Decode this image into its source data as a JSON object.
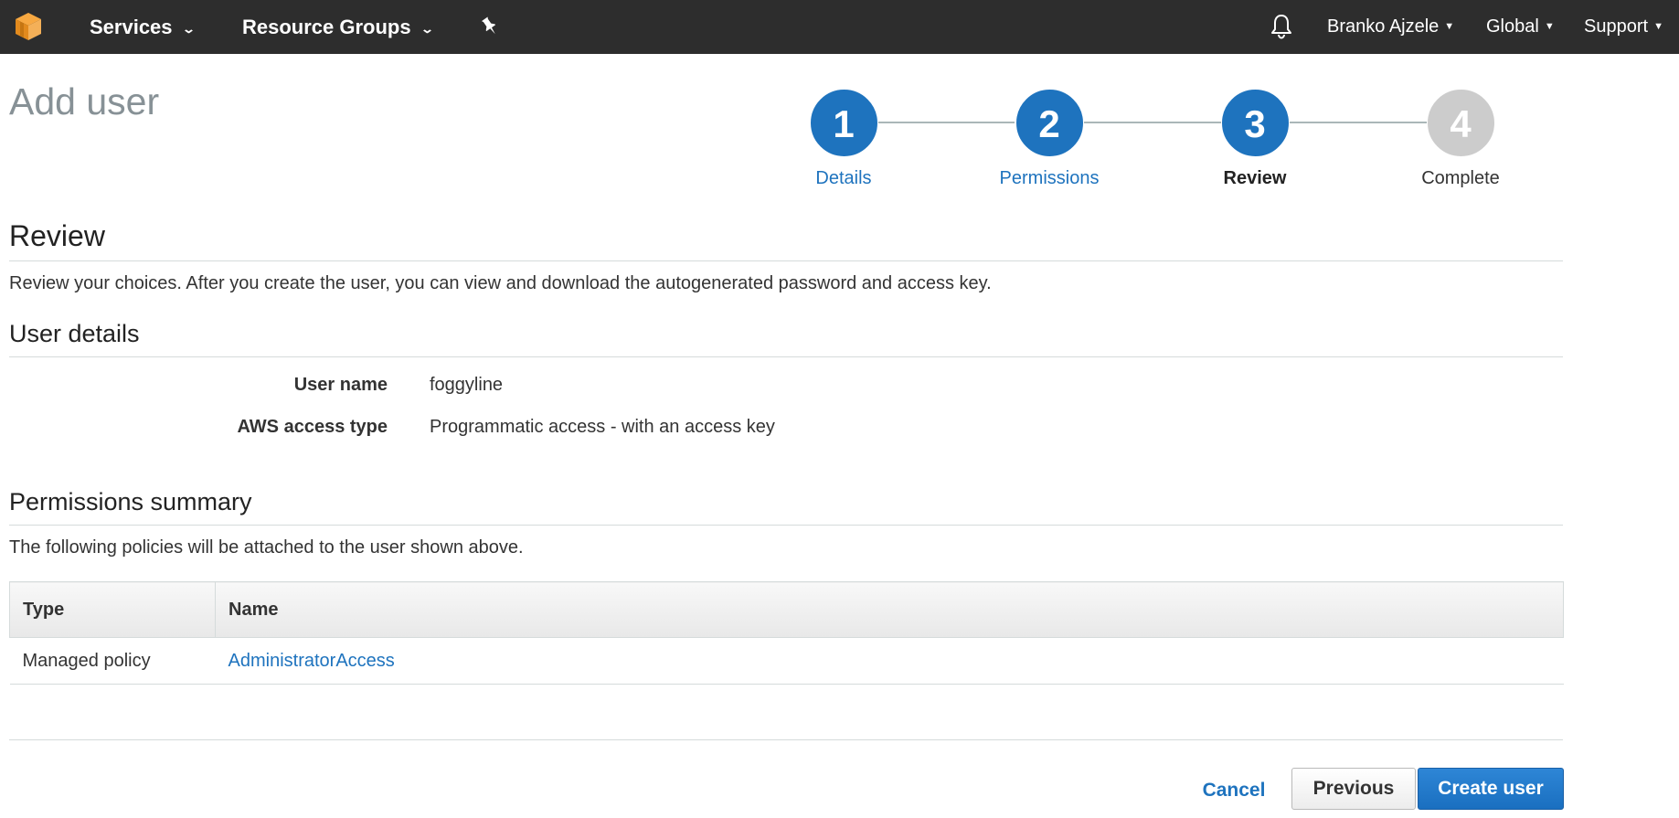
{
  "topnav": {
    "logo_icon": "aws-cube-icon",
    "services_label": "Services",
    "resource_groups_label": "Resource Groups",
    "pin_icon": "pushpin-icon",
    "bell_icon": "bell-icon",
    "user_label": "Branko Ajzele",
    "region_label": "Global",
    "support_label": "Support",
    "background_color": "#2d2d2d"
  },
  "page": {
    "title": "Add user"
  },
  "wizard": {
    "steps": [
      {
        "number": "1",
        "label": "Details",
        "state": "done"
      },
      {
        "number": "2",
        "label": "Permissions",
        "state": "done"
      },
      {
        "number": "3",
        "label": "Review",
        "state": "current"
      },
      {
        "number": "4",
        "label": "Complete",
        "state": "pending"
      }
    ],
    "active_color": "#1e73be",
    "pending_color": "#cccccc"
  },
  "review": {
    "heading": "Review",
    "description": "Review your choices. After you create the user, you can view and download the autogenerated password and access key."
  },
  "user_details": {
    "heading": "User details",
    "rows": [
      {
        "label": "User name",
        "value": "foggyline"
      },
      {
        "label": "AWS access type",
        "value": "Programmatic access - with an access key"
      }
    ]
  },
  "permissions": {
    "heading": "Permissions summary",
    "description": "The following policies will be attached to the user shown above.",
    "columns": [
      "Type",
      "Name"
    ],
    "rows": [
      {
        "type": "Managed policy",
        "name": "AdministratorAccess"
      }
    ]
  },
  "footer": {
    "cancel_label": "Cancel",
    "previous_label": "Previous",
    "create_label": "Create user"
  }
}
